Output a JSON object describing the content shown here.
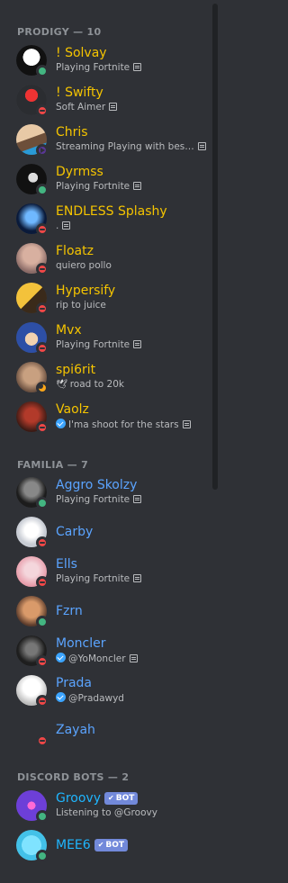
{
  "groups": [
    {
      "header": "PRODIGY — 10",
      "members": [
        {
          "name": "! Solvay",
          "status": "online",
          "activity": "Playing Fortnite",
          "rp": true
        },
        {
          "name": "! Swifty",
          "status": "dnd",
          "activity": "Soft Aimer",
          "rp": true
        },
        {
          "name": "Chris",
          "status": "streaming",
          "activity": "Streaming Playing with bes…",
          "rp": true
        },
        {
          "name": "Dyrmss",
          "status": "online",
          "activity": "Playing Fortnite",
          "rp": true
        },
        {
          "name": "ENDLESS Splashy",
          "status": "dnd",
          "activity": ".",
          "rp": true
        },
        {
          "name": "Floatz",
          "status": "dnd",
          "activity": "quiero pollo",
          "rp": false
        },
        {
          "name": "Hypersify",
          "status": "dnd",
          "activity": "rip to juice",
          "rp": false
        },
        {
          "name": "Mvx",
          "status": "dnd",
          "activity": "Playing Fortnite",
          "rp": true
        },
        {
          "name": "spi6rit",
          "status": "idle",
          "activity": "road to 20k",
          "rp": false
        },
        {
          "name": "Vaolz",
          "status": "dnd",
          "activity": "I'ma shoot for the stars",
          "rp": true
        }
      ]
    },
    {
      "header": "FAMILIA — 7",
      "members": [
        {
          "name": "Aggro Skolzy",
          "status": "online",
          "activity": "Playing Fortnite",
          "rp": true
        },
        {
          "name": "Carby",
          "status": "dnd",
          "activity": "",
          "rp": false
        },
        {
          "name": "Ells",
          "status": "dnd",
          "activity": "Playing Fortnite",
          "rp": true
        },
        {
          "name": "Fzrn",
          "status": "online",
          "activity": "",
          "rp": false
        },
        {
          "name": "Moncler",
          "status": "dnd",
          "activity": "@YoMoncler",
          "rp": true
        },
        {
          "name": "Prada",
          "status": "dnd",
          "activity": "@Pradawyd",
          "rp": false
        },
        {
          "name": "Zayah",
          "status": "dnd",
          "activity": "",
          "rp": false
        }
      ]
    },
    {
      "header": "DISCORD BOTS — 2",
      "members": [
        {
          "name": "Groovy",
          "status": "online",
          "activity": "Listening to @Groovy",
          "rp": false,
          "bot_tag": "BOT"
        },
        {
          "name": "MEE6",
          "status": "online",
          "activity": "",
          "rp": false,
          "bot_tag": "BOT"
        }
      ]
    }
  ],
  "colors": {
    "background": "#2f3136",
    "role_prodigy": "#f5c400",
    "role_familia": "#5ba4ff",
    "role_bot": "#1fb6ff",
    "online": "#43b581",
    "dnd": "#f04747",
    "idle": "#faa61a",
    "streaming": "#593695",
    "bot_tag": "#7289da"
  }
}
